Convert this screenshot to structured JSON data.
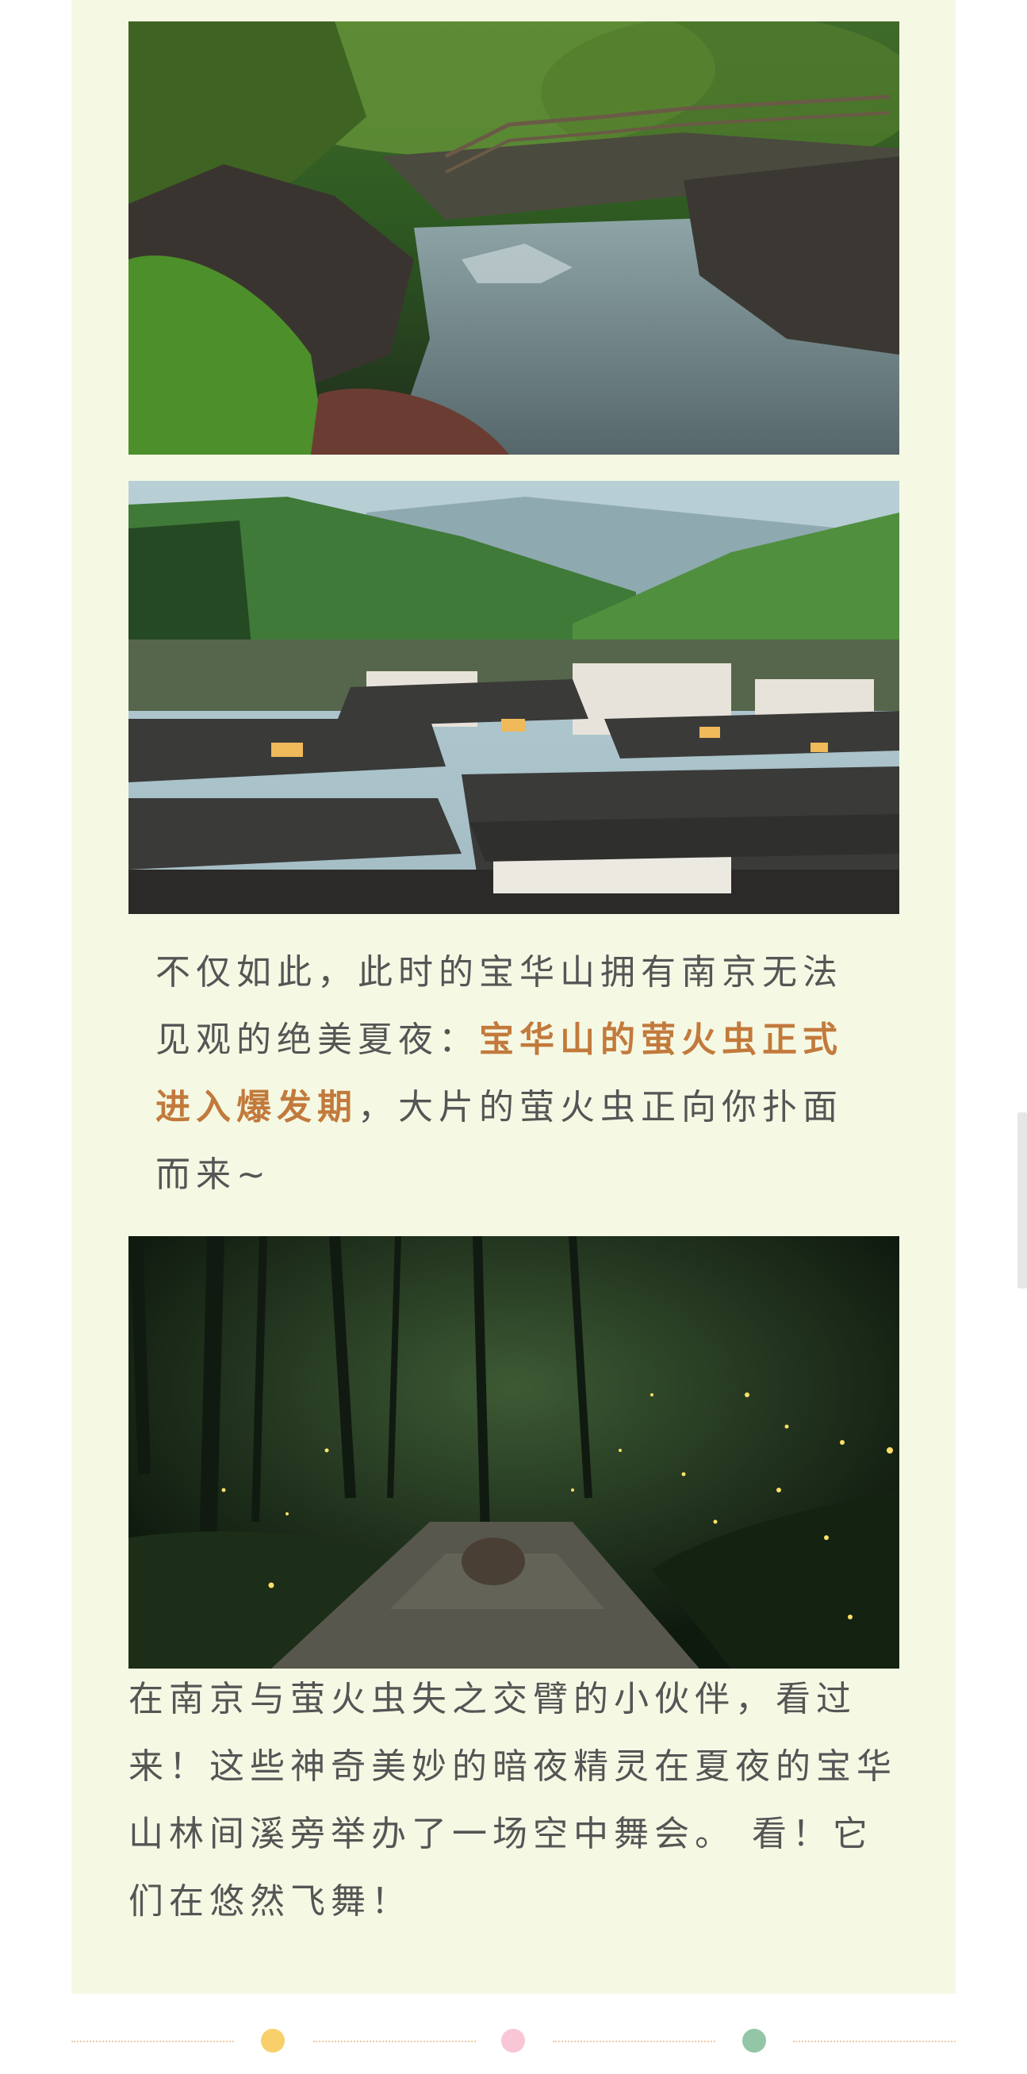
{
  "article": {
    "paragraph_1": {
      "before": "不仅如此，此时的宝华山拥有南京无法见观的绝美夏夜：",
      "highlight": "宝华山的萤火虫正式进入爆发期",
      "after": "，大片的萤火虫正向你扑面而来~"
    },
    "paragraph_2": "在南京与萤火虫失之交臂的小伙伴，看过来！这些神奇美妙的暗夜精灵在夏夜的宝华山林间溪旁举办了一场空中舞会。 看！它们在悠然飞舞！"
  },
  "colors": {
    "card_background": "#f5f9e4",
    "body_text": "#555555",
    "highlight_text": "#c27a3c",
    "divider_line": "#efc9a4",
    "dots": [
      "#f8cf6a",
      "#f8c6d5",
      "#92c6a7"
    ]
  },
  "images": [
    {
      "name": "forest-stream-photo"
    },
    {
      "name": "mountain-village-photo"
    },
    {
      "name": "firefly-forest-path-photo"
    }
  ]
}
